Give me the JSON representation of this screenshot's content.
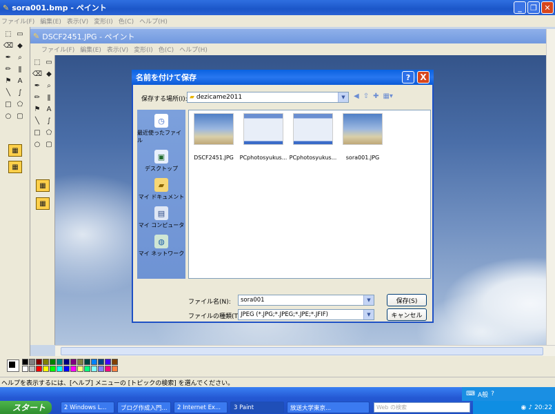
{
  "outer_window": {
    "title": "sora001.bmp - ペイント",
    "menu": [
      "ファイル(F)",
      "編集(E)",
      "表示(V)",
      "変形(I)",
      "色(C)",
      "ヘルプ(H)"
    ]
  },
  "inner_window": {
    "title": "DSCF2451.JPG - ペイント",
    "menu": [
      "ファイル(F)",
      "編集(E)",
      "表示(V)",
      "変形(I)",
      "色(C)",
      "ヘルプ(H)"
    ]
  },
  "dialog": {
    "title": "名前を付けて保存",
    "help_label": "?",
    "close_label": "X",
    "save_in_label": "保存する場所(I):",
    "save_in_value": "dezicame2011",
    "places": [
      "最近使ったファイル",
      "デスクトップ",
      "マイ ドキュメント",
      "マイ コンピュータ",
      "マイ ネットワーク"
    ],
    "files": [
      "DSCF2451.JPG",
      "PCphotosyukus...",
      "PCphotosyukus...",
      "sora001.JPG"
    ],
    "filename_label": "ファイル名(N):",
    "filename_value": "sora001",
    "filetype_label": "ファイルの種類(T):",
    "filetype_value": "JPEG (*.JPG;*.JPEG;*.JPE;*.JFIF)",
    "save_button": "保存(S)",
    "cancel_button": "キャンセル"
  },
  "status_text": "ヘルプを表示するには、[ヘルプ] メニューの [トピックの検索] を選んでください。",
  "taskbar": {
    "start_label": "スタート",
    "tasks": [
      "2 Windows L...",
      "ブログ作成入門...",
      "2 Internet Ex...",
      "3 Paint",
      "放送大学東京..."
    ],
    "search_placeholder": "Web の検索",
    "clock": "20:22"
  },
  "colors": {
    "title_bar": "#1b56c8",
    "dialog_title": "#0a62e0",
    "places_bar": "#7ca0dc"
  }
}
